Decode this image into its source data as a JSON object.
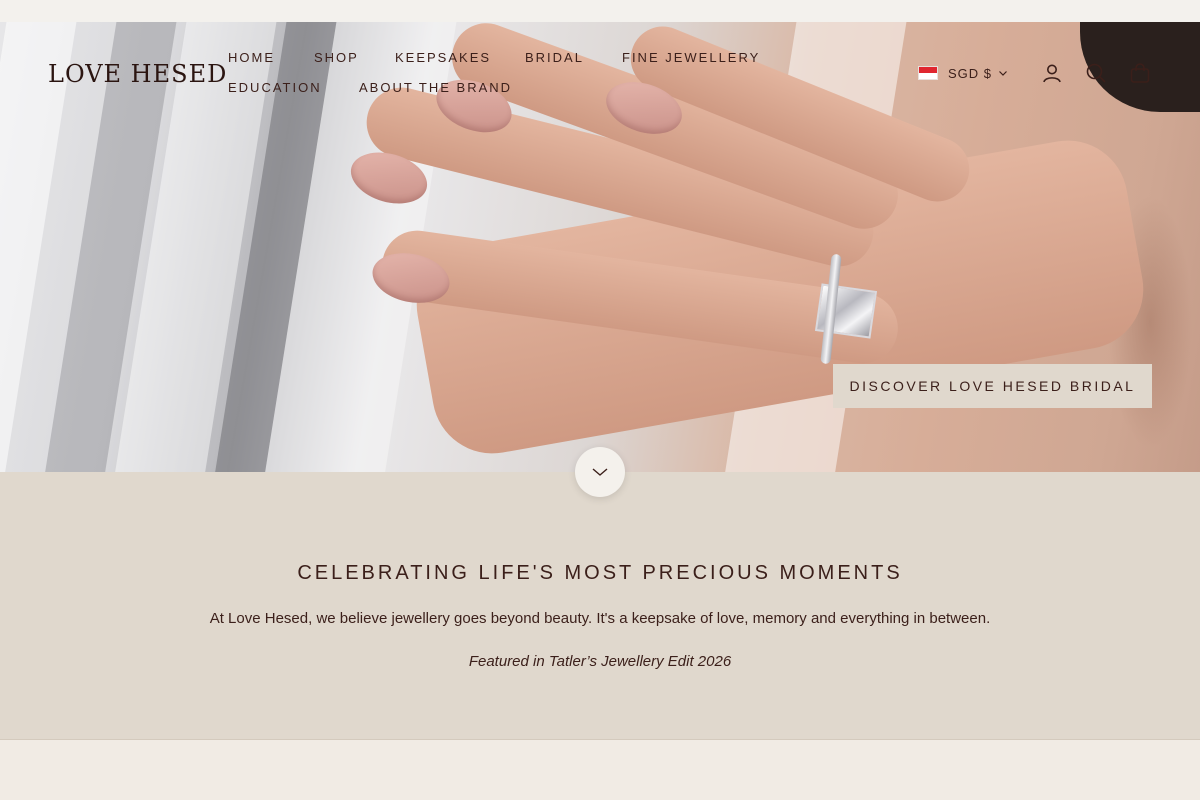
{
  "brand": {
    "logo_text": "LOVE HESED"
  },
  "nav": {
    "items": [
      {
        "label": "HOME"
      },
      {
        "label": "SHOP"
      },
      {
        "label": "KEEPSAKES"
      },
      {
        "label": "BRIDAL"
      },
      {
        "label": "FINE JEWELLERY"
      },
      {
        "label": "EDUCATION"
      },
      {
        "label": "ABOUT THE BRAND"
      }
    ]
  },
  "header_actions": {
    "currency": "SGD $",
    "currency_flag": "singapore-flag",
    "icons": [
      "account-icon",
      "search-icon",
      "cart-icon"
    ]
  },
  "hero": {
    "cta_label": "DISCOVER LOVE HESED BRIDAL",
    "scroll_icon": "chevron-down-icon"
  },
  "intro": {
    "title": "CELEBRATING LIFE'S MOST PRECIOUS MOMENTS",
    "text": "At Love Hesed, we believe jewellery goes beyond beauty. It's a keepsake of love, memory and everything in between.",
    "feature": "Featured in Tatler’s Jewellery Edit 2026"
  },
  "colors": {
    "text": "#3b1f1a",
    "hero_cta_bg": "#e0d8cd",
    "intro_bg": "#e0d8cd",
    "page_bg": "#f1ebe4"
  }
}
